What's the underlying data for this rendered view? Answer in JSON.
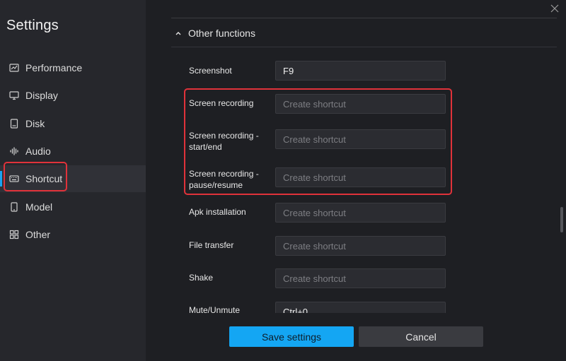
{
  "sidebar": {
    "title": "Settings",
    "items": [
      {
        "label": "Performance",
        "icon": "chart-icon"
      },
      {
        "label": "Display",
        "icon": "monitor-icon"
      },
      {
        "label": "Disk",
        "icon": "disk-icon"
      },
      {
        "label": "Audio",
        "icon": "audio-bars-icon"
      },
      {
        "label": "Shortcut",
        "icon": "keyboard-icon",
        "active": true
      },
      {
        "label": "Model",
        "icon": "phone-icon"
      },
      {
        "label": "Other",
        "icon": "grid-icon"
      }
    ]
  },
  "section": {
    "title": "Other functions",
    "expanded": true
  },
  "shortcuts": [
    {
      "label": "Screenshot",
      "value": "F9",
      "placeholder": "Create shortcut"
    },
    {
      "label": "Screen recording",
      "value": "",
      "placeholder": "Create shortcut"
    },
    {
      "label": "Screen recording - start/end",
      "value": "",
      "placeholder": "Create shortcut"
    },
    {
      "label": "Screen recording - pause/resume",
      "value": "",
      "placeholder": "Create shortcut"
    },
    {
      "label": "Apk installation",
      "value": "",
      "placeholder": "Create shortcut"
    },
    {
      "label": "File transfer",
      "value": "",
      "placeholder": "Create shortcut"
    },
    {
      "label": "Shake",
      "value": "",
      "placeholder": "Create shortcut"
    },
    {
      "label": "Mute/Unmute",
      "value": "Ctrl+0",
      "placeholder": "Create shortcut"
    }
  ],
  "footer": {
    "save_label": "Save settings",
    "cancel_label": "Cancel"
  },
  "colors": {
    "accent": "#14a6f3",
    "highlight": "#e0323a",
    "sidebar_bg": "#26272c",
    "content_bg": "#1e1f23"
  }
}
